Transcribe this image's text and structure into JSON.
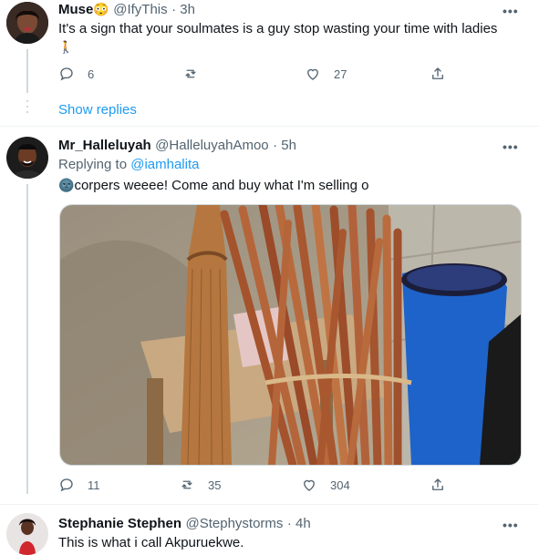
{
  "tweet1": {
    "name": "Muse",
    "name_emoji": "😳",
    "handle": "@IfyThis",
    "time": "· 3h",
    "text": "It's a sign that your soulmates is a guy stop wasting your time with ladies",
    "text_emoji": "🚶",
    "replies": "6",
    "retweets": "",
    "likes": "27",
    "avatar_icon": "avatar-woman",
    "show_replies": "Show replies"
  },
  "tweet2": {
    "name": "Mr_Halleluyah",
    "handle": "@HalleluyahAmoo",
    "time": "· 5h",
    "replying_to_label": "Replying to",
    "replying_to_handle": "@iamhalita",
    "text": "corpers weeee! Come and buy what I'm selling o",
    "text_emoji": "🌚",
    "replies": "11",
    "retweets": "35",
    "likes": "304",
    "avatar_icon": "avatar-man",
    "image": "photo-brooms-for-sale"
  },
  "tweet3": {
    "name": "Stephanie Stephen",
    "handle": "@Stephystorms",
    "time": "· 4h",
    "text": "This is what i call Akpuruekwe.",
    "avatar_icon": "avatar-woman-red"
  },
  "more_label": "•••",
  "colors": {
    "accent": "#1d9bf0",
    "muted": "#536471",
    "text": "#0f1419"
  }
}
